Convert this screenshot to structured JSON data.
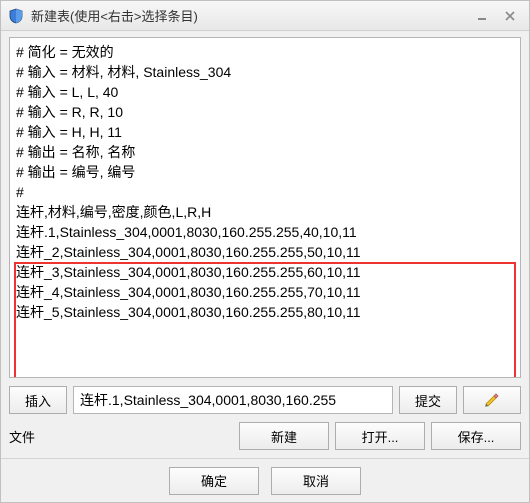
{
  "titlebar": {
    "title": "新建表(使用<右击>选择条目)"
  },
  "textarea": {
    "lines": [
      "# 简化 = 无效的",
      "# 输入 = 材料, 材料, Stainless_304",
      "# 输入 = L, L, 40",
      "# 输入 = R, R, 10",
      "# 输入 = H, H, 11",
      "# 输出 = 名称, 名称",
      "# 输出 = 编号, 编号",
      "#",
      "连杆,材料,编号,密度,颜色,L,R,H",
      "",
      "连杆.1,Stainless_304,0001,8030,160.255.255,40,10,11",
      "连杆_2,Stainless_304,0001,8030,160.255.255,50,10,11",
      "连杆_3,Stainless_304,0001,8030,160.255.255,60,10,11",
      "连杆_4,Stainless_304,0001,8030,160.255.255,70,10,11",
      "连杆_5,Stainless_304,0001,8030,160.255.255,80,10,11"
    ]
  },
  "insert_row": {
    "insert_label": "插入",
    "input_value": "连杆.1,Stainless_304,0001,8030,160.255",
    "submit_label": "提交"
  },
  "file_row": {
    "file_label": "文件",
    "new_label": "新建",
    "open_label": "打开...",
    "save_label": "保存..."
  },
  "bottom": {
    "ok_label": "确定",
    "cancel_label": "取消"
  }
}
